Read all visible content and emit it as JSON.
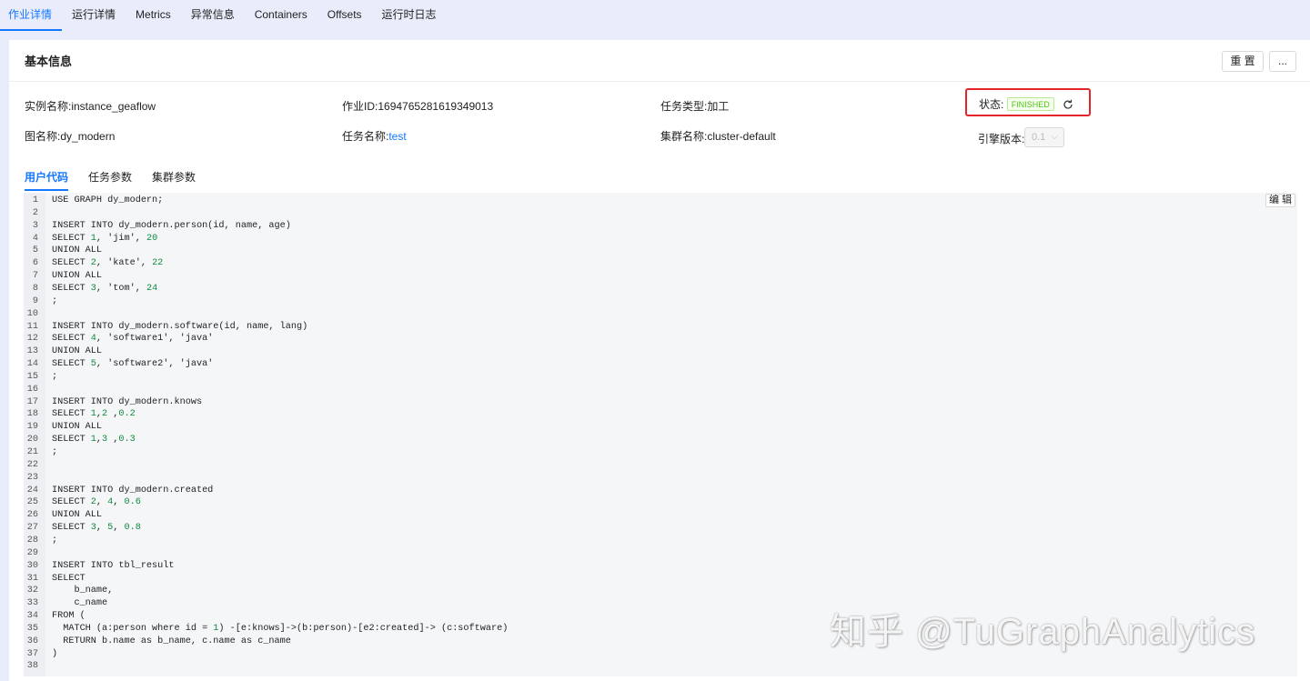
{
  "topnav": {
    "tabs": [
      {
        "label": "作业详情",
        "active": true
      },
      {
        "label": "运行详情",
        "active": false
      },
      {
        "label": "Metrics",
        "active": false
      },
      {
        "label": "异常信息",
        "active": false
      },
      {
        "label": "Containers",
        "active": false
      },
      {
        "label": "Offsets",
        "active": false
      },
      {
        "label": "运行时日志",
        "active": false
      }
    ]
  },
  "card": {
    "title": "基本信息",
    "reset_label": "重 置",
    "more_label": "..."
  },
  "info": {
    "instance_label": "实例名称:",
    "instance_value": "instance_geaflow",
    "job_id_label": "作业ID:",
    "job_id_value": "1694765281619349013",
    "task_type_label": "任务类型:",
    "task_type_value": "加工",
    "status_label": "状态:",
    "status_value": "FINISHED",
    "graph_label": "图名称:",
    "graph_value": "dy_modern",
    "task_name_label": "任务名称:",
    "task_name_value": "test",
    "cluster_label": "集群名称:",
    "cluster_value": "cluster-default",
    "engine_label": "引擎版本:",
    "engine_value": "0.1"
  },
  "subtabs": [
    {
      "label": "用户代码",
      "active": true
    },
    {
      "label": "任务参数",
      "active": false
    },
    {
      "label": "集群参数",
      "active": false
    }
  ],
  "editor": {
    "edit_label": "编 辑",
    "lines": [
      "USE GRAPH dy_modern;",
      "",
      "INSERT INTO dy_modern.person(id, name, age)",
      "SELECT 1, 'jim', 20",
      "UNION ALL",
      "SELECT 2, 'kate', 22",
      "UNION ALL",
      "SELECT 3, 'tom', 24",
      ";",
      "",
      "INSERT INTO dy_modern.software(id, name, lang)",
      "SELECT 4, 'software1', 'java'",
      "UNION ALL",
      "SELECT 5, 'software2', 'java'",
      ";",
      "",
      "INSERT INTO dy_modern.knows",
      "SELECT 1,2 ,0.2",
      "UNION ALL",
      "SELECT 1,3 ,0.3",
      ";",
      "",
      "",
      "INSERT INTO dy_modern.created",
      "SELECT 2, 4, 0.6",
      "UNION ALL",
      "SELECT 3, 5, 0.8",
      ";",
      "",
      "INSERT INTO tbl_result",
      "SELECT",
      "    b_name,",
      "    c_name",
      "FROM (",
      "  MATCH (a:person where id = 1) -[e:knows]->(b:person)-[e2:created]-> (c:software)",
      "  RETURN b.name as b_name, c.name as c_name",
      ")",
      ""
    ]
  },
  "watermark": "知乎 @TuGraphAnalytics"
}
